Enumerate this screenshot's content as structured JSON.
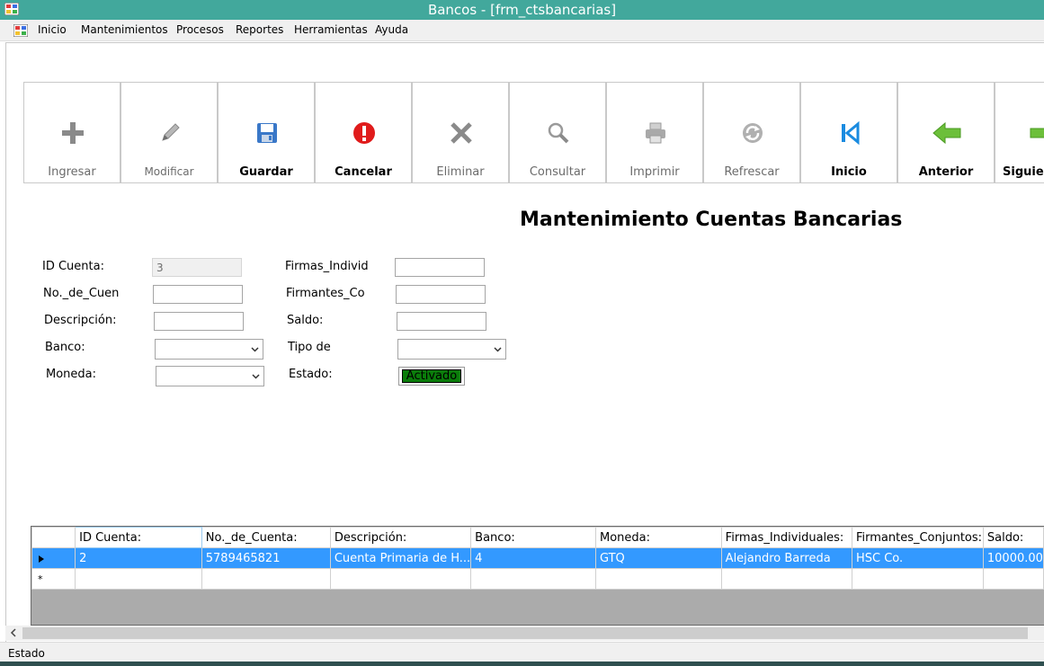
{
  "window": {
    "title": "Bancos - [frm_ctsbancarias]"
  },
  "menu": [
    "Inicio",
    "Mantenimientos",
    "Procesos",
    "Reportes",
    "Herramientas",
    "Ayuda"
  ],
  "toolbar": [
    {
      "label": "Ingresar",
      "icon": "plus-icon",
      "state": "disabled"
    },
    {
      "label": "Modificar",
      "icon": "pencil-icon",
      "state": "disabled"
    },
    {
      "label": "Guardar",
      "icon": "save-icon",
      "state": "enabled"
    },
    {
      "label": "Cancelar",
      "icon": "alert-icon",
      "state": "enabled"
    },
    {
      "label": "Eliminar",
      "icon": "delete-x-icon",
      "state": "disabled"
    },
    {
      "label": "Consultar",
      "icon": "magnifier-icon",
      "state": "disabled"
    },
    {
      "label": "Imprimir",
      "icon": "printer-icon",
      "state": "disabled"
    },
    {
      "label": "Refrescar",
      "icon": "refresh-icon",
      "state": "disabled"
    },
    {
      "label": "Inicio",
      "icon": "first-record-icon",
      "state": "enabled"
    },
    {
      "label": "Anterior",
      "icon": "arrow-left-icon",
      "state": "enabled"
    },
    {
      "label": "Siguiente",
      "icon": "arrow-right-icon",
      "state": "enabled"
    }
  ],
  "form": {
    "title": "Mantenimiento Cuentas Bancarias",
    "labels": {
      "id_cuenta": "ID Cuenta:",
      "no_cuenta": "No._de_Cuen",
      "descripcion": "Descripción:",
      "banco": "Banco:",
      "moneda": "Moneda:",
      "firmas": "Firmas_Individ",
      "firmantes": "Firmantes_Co",
      "saldo": "Saldo:",
      "tipo": "Tipo de",
      "estado": "Estado:"
    },
    "values": {
      "id_cuenta": "3",
      "estado": "Activado"
    }
  },
  "grid": {
    "columns": [
      "ID Cuenta:",
      "No._de_Cuenta:",
      "Descripción:",
      "Banco:",
      "Moneda:",
      "Firmas_Individuales:",
      "Firmantes_Conjuntos:",
      "Saldo:"
    ],
    "rows": [
      [
        "2",
        "5789465821",
        "Cuenta Primaria de H...",
        "4",
        "GTQ",
        "Alejandro Barreda",
        "HSC Co.",
        "10000.00"
      ]
    ],
    "new_row_marker": "*"
  },
  "status": {
    "text": "Estado"
  },
  "colors": {
    "titlebar": "#42a89c",
    "selection": "#3399ff",
    "status_active": "#0a7d0a"
  }
}
